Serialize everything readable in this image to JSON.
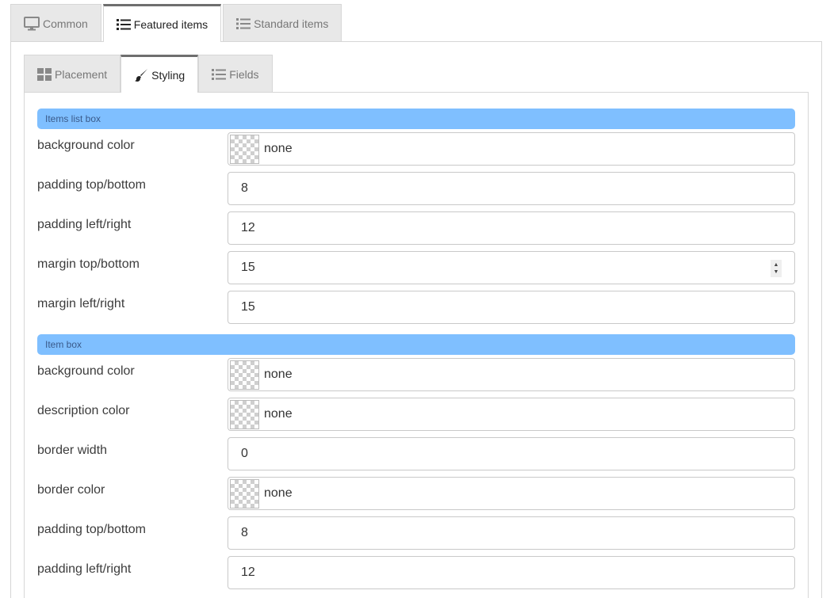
{
  "top_tabs": [
    {
      "label": "Common",
      "icon": "monitor-icon",
      "active": false
    },
    {
      "label": "Featured items",
      "icon": "list-icon",
      "active": true
    },
    {
      "label": "Standard items",
      "icon": "list-icon",
      "active": false
    }
  ],
  "sub_tabs": [
    {
      "label": "Placement",
      "icon": "grid-icon",
      "active": false
    },
    {
      "label": "Styling",
      "icon": "brush-icon",
      "active": true
    },
    {
      "label": "Fields",
      "icon": "list-icon",
      "active": false
    }
  ],
  "sections": [
    {
      "title": "Items list box",
      "rows": [
        {
          "label": "background color",
          "value": "none",
          "type": "color"
        },
        {
          "label": "padding top/bottom",
          "value": "8",
          "type": "text"
        },
        {
          "label": "padding left/right",
          "value": "12",
          "type": "text"
        },
        {
          "label": "margin top/bottom",
          "value": "15",
          "type": "number"
        },
        {
          "label": "margin left/right",
          "value": "15",
          "type": "text"
        }
      ]
    },
    {
      "title": "Item box",
      "rows": [
        {
          "label": "background color",
          "value": "none",
          "type": "color"
        },
        {
          "label": "description color",
          "value": "none",
          "type": "color"
        },
        {
          "label": "border width",
          "value": "0",
          "type": "text"
        },
        {
          "label": "border color",
          "value": "none",
          "type": "color"
        },
        {
          "label": "padding top/bottom",
          "value": "8",
          "type": "text"
        },
        {
          "label": "padding left/right",
          "value": "12",
          "type": "text"
        }
      ]
    }
  ],
  "colors": {
    "section_header_bg": "#7fbfff",
    "active_tab_border": "#6e6e6e"
  }
}
